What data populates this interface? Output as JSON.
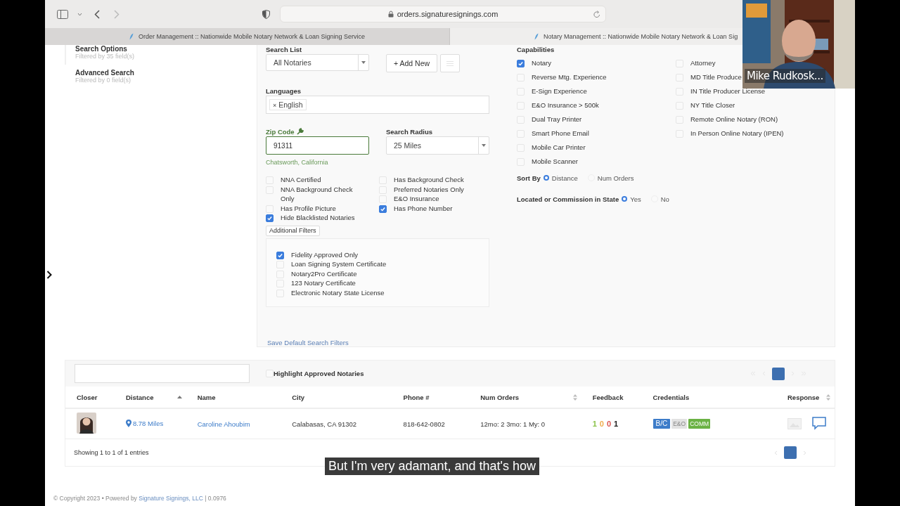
{
  "browser": {
    "url": "orders.signaturesignings.com",
    "tabs": [
      {
        "title": "Order Management :: Nationwide Mobile Notary Network & Loan Signing Service",
        "selected": false
      },
      {
        "title": "Notary Management :: Nationwide Mobile Notary Network & Loan Sig",
        "selected": true
      }
    ]
  },
  "sidebar": {
    "items": [
      {
        "title": "Search Options",
        "subtitle": "Filtered by 35 field(s)",
        "selected": true
      },
      {
        "title": "Advanced Search",
        "subtitle": "Filtered by 0 field(s)",
        "selected": false
      }
    ]
  },
  "search_panel": {
    "search_list": {
      "label": "Search List",
      "value": "All Notaries"
    },
    "add_button": "+ Add New",
    "languages": {
      "label": "Languages",
      "tags": [
        {
          "remove": "×",
          "label": "English"
        }
      ]
    },
    "zip_code": {
      "label": "Zip Code",
      "value": "91311",
      "location": "Chatsworth, California"
    },
    "search_radius": {
      "label": "Search Radius",
      "value": "25 Miles"
    },
    "filters_left": [
      {
        "label": "NNA Certified",
        "checked": false
      },
      {
        "label": "NNA Background Check Only",
        "checked": false
      },
      {
        "label": "Has Profile Picture",
        "checked": false
      },
      {
        "label": "Hide Blacklisted Notaries",
        "checked": true
      }
    ],
    "filters_right": [
      {
        "label": "Has Background Check",
        "checked": false
      },
      {
        "label": "Preferred Notaries Only",
        "checked": false
      },
      {
        "label": "E&O Insurance",
        "checked": false
      },
      {
        "label": "Has Phone Number",
        "checked": true
      }
    ],
    "additional_filters_button": "Additional Filters",
    "additional_filters": [
      {
        "label": "Fidelity Approved Only",
        "checked": true
      },
      {
        "label": "Loan Signing System Certificate",
        "checked": false
      },
      {
        "label": "Notary2Pro Certificate",
        "checked": false
      },
      {
        "label": "123 Notary Certificate",
        "checked": false
      },
      {
        "label": "Electronic Notary State License",
        "checked": false
      }
    ],
    "save_link": "Save Default Search Filters"
  },
  "capabilities": {
    "label": "Capabilities",
    "left": [
      {
        "label": "Notary",
        "checked": true
      },
      {
        "label": "Reverse Mtg. Experience",
        "checked": false
      },
      {
        "label": "E-Sign Experience",
        "checked": false
      },
      {
        "label": "E&O Insurance > 500k",
        "checked": false
      },
      {
        "label": "Dual Tray Printer",
        "checked": false
      },
      {
        "label": "Smart Phone Email",
        "checked": false
      },
      {
        "label": "Mobile Car Printer",
        "checked": false
      },
      {
        "label": "Mobile Scanner",
        "checked": false
      }
    ],
    "right": [
      {
        "label": "Attorney",
        "checked": false
      },
      {
        "label": "MD Title Produce",
        "checked": false
      },
      {
        "label": "IN Title Producer License",
        "checked": false
      },
      {
        "label": "NY Title Closer",
        "checked": false
      },
      {
        "label": "Remote Online Notary (RON)",
        "checked": false
      },
      {
        "label": "In Person Online Notary (IPEN)",
        "checked": false
      }
    ]
  },
  "sort_by": {
    "label": "Sort By",
    "options": [
      {
        "label": "Distance",
        "selected": true
      },
      {
        "label": "Num Orders",
        "selected": false
      }
    ]
  },
  "located": {
    "label": "Located or Commission in State",
    "options": [
      {
        "label": "Yes",
        "selected": true
      },
      {
        "label": "No",
        "selected": false
      }
    ]
  },
  "results": {
    "highlight": {
      "label": "Highlight Approved Notaries",
      "checked": false
    },
    "columns": [
      {
        "label": "Closer"
      },
      {
        "label": "Distance",
        "sorted_ascending": true
      },
      {
        "label": "Name"
      },
      {
        "label": "City"
      },
      {
        "label": "Phone #"
      },
      {
        "label": "Num Orders",
        "sortable": true
      },
      {
        "label": "Feedback"
      },
      {
        "label": "Credentials"
      },
      {
        "label": "Response",
        "sortable": true
      }
    ],
    "rows": [
      {
        "distance": "8.78 Miles",
        "name": "Caroline Ahoubim",
        "city": "Calabasas, CA 91302",
        "phone": "818-642-0802",
        "num_orders": "12mo: 2 3mo: 1 My: 0",
        "feedback": [
          {
            "value": "1",
            "color": "#8bc34a"
          },
          {
            "value": "0",
            "color": "#f0ad4e"
          },
          {
            "value": "0",
            "color": "#d9534f"
          },
          {
            "value": "1",
            "color": "#222222"
          }
        ],
        "credentials": [
          {
            "label": "B/C",
            "color": "#3d7cc9"
          },
          {
            "label": "E&O",
            "color": "#e2e2e2"
          },
          {
            "label": "COMM",
            "color": "#6bb244"
          }
        ]
      }
    ],
    "info": "Showing 1 to 1 of 1 entries"
  },
  "footer": {
    "text": "© Copyright 2023 • Powered by",
    "link": "Signature Signings, LLC",
    "version": "| 0.0976"
  },
  "video": {
    "name": "Mike Rudkosk..."
  },
  "caption": "But I'm very adamant, and that's how"
}
